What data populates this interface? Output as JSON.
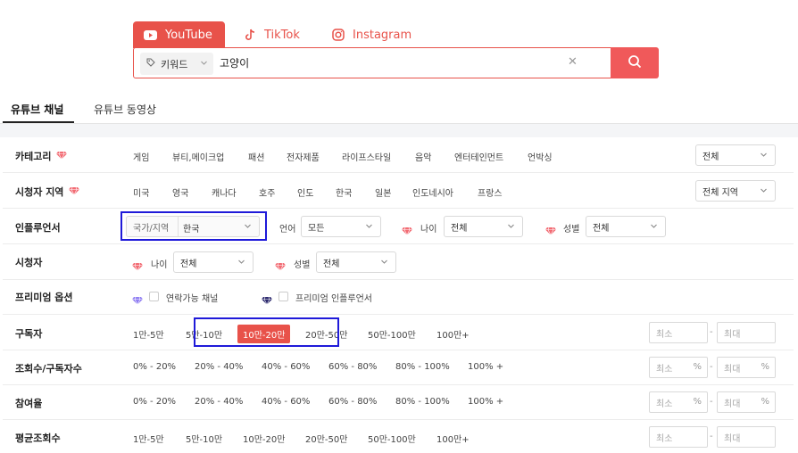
{
  "platform_tabs": {
    "youtube": "YouTube",
    "tiktok": "TikTok",
    "instagram": "Instagram"
  },
  "search": {
    "type_label": "키워드",
    "query": "고양이",
    "clear_symbol": "✕"
  },
  "content_tabs": {
    "channels": "유튜브 채널",
    "videos": "유튜브 동영상"
  },
  "filters": {
    "category": {
      "label": "카테고리",
      "options": [
        "게임",
        "뷰티,메이크업",
        "패션",
        "전자제품",
        "라이프스타일",
        "음악",
        "엔터테인먼트",
        "언박싱"
      ],
      "select_value": "전체"
    },
    "viewer_region": {
      "label": "시청자 지역",
      "options": [
        "미국",
        "영국",
        "캐나다",
        "호주",
        "인도",
        "한국",
        "일본",
        "인도네시아",
        "프랑스"
      ],
      "select_value": "전체 지역"
    },
    "influencer": {
      "label": "인플루언서",
      "country_label": "국가/지역",
      "country_value": "한국",
      "language_label": "언어",
      "language_value": "모든",
      "age_label": "나이",
      "age_value": "전체",
      "gender_label": "성별",
      "gender_value": "전체"
    },
    "viewers": {
      "label": "시청자",
      "age_label": "나이",
      "age_value": "전체",
      "gender_label": "성별",
      "gender_value": "전체"
    },
    "premium": {
      "label": "프리미엄 옵션",
      "contactable": "연락가능 채널",
      "premium_influencer": "프리미엄 인플루언서"
    },
    "subscribers": {
      "label": "구독자",
      "options": [
        "1만-5만",
        "5만-10만",
        "10만-20만",
        "20만-50만",
        "50만-100만",
        "100만+"
      ],
      "selected": "10만-20만",
      "min_placeholder": "최소",
      "max_placeholder": "최대",
      "dash": "-"
    },
    "views_ratio": {
      "label": "조회수/구독자수",
      "options": [
        "0% - 20%",
        "20% - 40%",
        "40% - 60%",
        "60% - 80%",
        "80% - 100%",
        "100% +"
      ],
      "min_placeholder": "최소",
      "max_placeholder": "최대",
      "unit": "%",
      "dash": "-"
    },
    "engagement": {
      "label": "참여율",
      "options": [
        "0% - 20%",
        "20% - 40%",
        "40% - 60%",
        "60% - 80%",
        "80% - 100%",
        "100% +"
      ],
      "min_placeholder": "최소",
      "max_placeholder": "최대",
      "unit": "%",
      "dash": "-"
    },
    "avg_views": {
      "label": "평균조회수",
      "options": [
        "1만-5만",
        "5만-10만",
        "10만-20만",
        "20만-50만",
        "50만-100만",
        "100만+"
      ],
      "min_placeholder": "최소",
      "max_placeholder": "최대",
      "dash": "-"
    }
  },
  "colors": {
    "accent": "#e8524a",
    "highlight": "#1f1ad9",
    "gem_pink": "#f26b73",
    "gem_purple": "#8f7df2",
    "gem_dark": "#2d2a6e"
  }
}
